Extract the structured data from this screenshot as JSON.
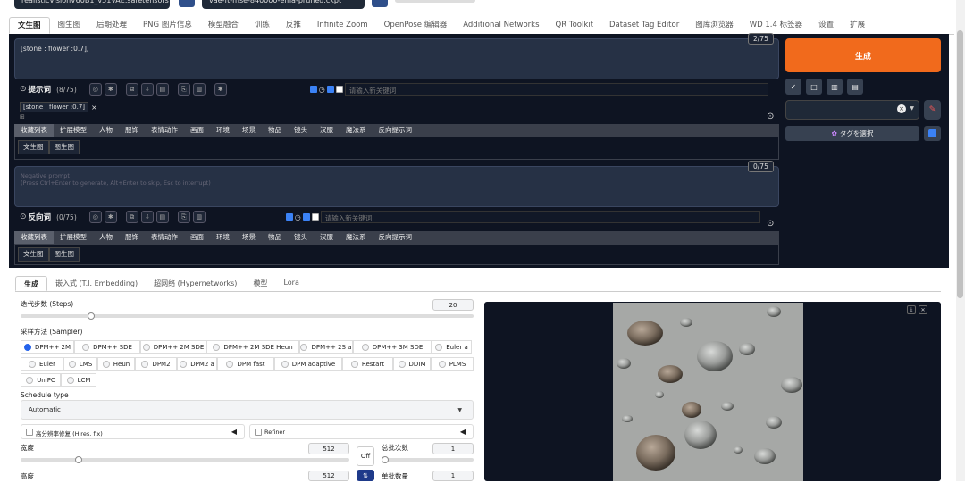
{
  "top": {
    "model_select": "realisticVisionV60B1_v51VAE.safetensors [15012c538f]",
    "vae_select": "vae-ft-mse-840000-ema-pruned.ckpt"
  },
  "tabs": [
    "文生图",
    "图生图",
    "后期处理",
    "PNG 图片信息",
    "模型融合",
    "训练",
    "反推",
    "Infinite Zoom",
    "OpenPose 编辑器",
    "Additional Networks",
    "QR Toolkit",
    "Dataset Tag Editor",
    "图库浏览器",
    "WD 1.4 标签器",
    "设置",
    "扩展"
  ],
  "prompt": {
    "text": "[stone : flower :0.7],",
    "counter": "2/75",
    "label": "提示词",
    "count": "(8/75)",
    "kw_placeholder": "请输入新关键词",
    "chip": "[stone : flower :0.7]",
    "chip_close": "×"
  },
  "neg": {
    "text_line1": "Negative prompt",
    "text_line2": "(Press Ctrl+Enter to generate, Alt+Enter to skip, Esc to interrupt)",
    "counter": "0/75",
    "label": "反向词",
    "count": "(0/75)",
    "kw_placeholder": "请输入新关键词"
  },
  "cat_tabs": [
    "收藏列表",
    "扩展模型",
    "人物",
    "服饰",
    "表情动作",
    "画面",
    "环境",
    "场景",
    "物品",
    "镜头",
    "汉服",
    "魔法系",
    "反向提示词"
  ],
  "sub_tabs": [
    "文生图",
    "图生图"
  ],
  "right": {
    "generate": "生成",
    "tag_select": "タグを選択",
    "style_clear": "×"
  },
  "icons": {
    "tool_buttons": [
      "✓",
      "□",
      "▥",
      "▤"
    ]
  },
  "bottom": {
    "tabs": [
      "生成",
      "嵌入式 (T.I. Embedding)",
      "超网络 (Hypernetworks)",
      "模型",
      "Lora"
    ],
    "steps_label": "迭代步数 (Steps)",
    "steps": "20",
    "steps_fraction": 0.15,
    "sampler_label": "采样方法 (Sampler)",
    "samplers_row1": [
      "DPM++ 2M",
      "DPM++ SDE",
      "DPM++ 2M SDE",
      "DPM++ 2M SDE Heun",
      "DPM++ 2S a",
      "DPM++ 3M SDE",
      "Euler a"
    ],
    "samplers_row2": [
      "Euler",
      "LMS",
      "Heun",
      "DPM2",
      "DPM2 a",
      "DPM fast",
      "DPM adaptive",
      "Restart",
      "DDIM",
      "PLMS"
    ],
    "samplers_row3": [
      "UniPC",
      "LCM"
    ],
    "selected_sampler": "DPM++ 2M",
    "schedule_label": "Schedule type",
    "schedule": "Automatic",
    "hires": "高分辨率修复 (Hires. fix)",
    "refiner": "Refiner",
    "width_label": "宽度",
    "width": "512",
    "width_fraction": 0.17,
    "height_label": "高度",
    "height": "512",
    "swap": "⇅",
    "off": "Off",
    "batch_count_label": "总批次数",
    "batch_count": "1",
    "batch_size_label": "单批数量",
    "batch_size": "1"
  }
}
